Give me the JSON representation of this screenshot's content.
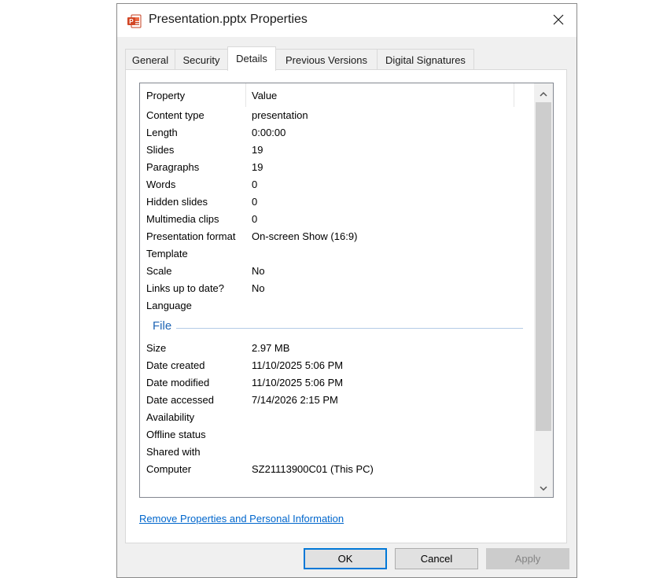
{
  "window": {
    "title": "Presentation.pptx Properties",
    "close_glyph": "✕"
  },
  "tabs": [
    {
      "label": "General",
      "active": false
    },
    {
      "label": "Security",
      "active": false
    },
    {
      "label": "Details",
      "active": true
    },
    {
      "label": "Previous Versions",
      "active": false
    },
    {
      "label": "Digital Signatures",
      "active": false
    }
  ],
  "list": {
    "header": {
      "property": "Property",
      "value": "Value"
    },
    "presentation_rows": [
      {
        "property": "Content type",
        "value": "presentation"
      },
      {
        "property": "Length",
        "value": "0:00:00"
      },
      {
        "property": "Slides",
        "value": "19"
      },
      {
        "property": "Paragraphs",
        "value": "19"
      },
      {
        "property": "Words",
        "value": "0"
      },
      {
        "property": "Hidden slides",
        "value": "0"
      },
      {
        "property": "Multimedia clips",
        "value": "0"
      },
      {
        "property": "Presentation format",
        "value": "On-screen Show (16:9)"
      },
      {
        "property": "Template",
        "value": ""
      },
      {
        "property": "Scale",
        "value": "No"
      },
      {
        "property": "Links up to date?",
        "value": "No"
      },
      {
        "property": "Language",
        "value": ""
      }
    ],
    "file_group_label": "File",
    "file_rows": [
      {
        "property": "Size",
        "value": "2.97 MB"
      },
      {
        "property": "Date created",
        "value": "11/10/2025 5:06 PM"
      },
      {
        "property": "Date modified",
        "value": "11/10/2025 5:06 PM"
      },
      {
        "property": "Date accessed",
        "value": "7/14/2026 2:15 PM"
      },
      {
        "property": "Availability",
        "value": ""
      },
      {
        "property": "Offline status",
        "value": ""
      },
      {
        "property": "Shared with",
        "value": ""
      },
      {
        "property": "Computer",
        "value": "SZ21113900C01 (This PC)"
      }
    ]
  },
  "remove_link": "Remove Properties and Personal Information",
  "buttons": {
    "ok": "OK",
    "cancel": "Cancel",
    "apply": "Apply"
  },
  "colors": {
    "accent": "#0078d7",
    "group_label": "#1e64b4",
    "link": "#0066cc",
    "ppt_icon": "#d24726"
  },
  "icons": {
    "app": "powerpoint-file-icon",
    "close": "close-icon",
    "scroll_up": "chevron-up-icon",
    "scroll_down": "chevron-down-icon"
  }
}
